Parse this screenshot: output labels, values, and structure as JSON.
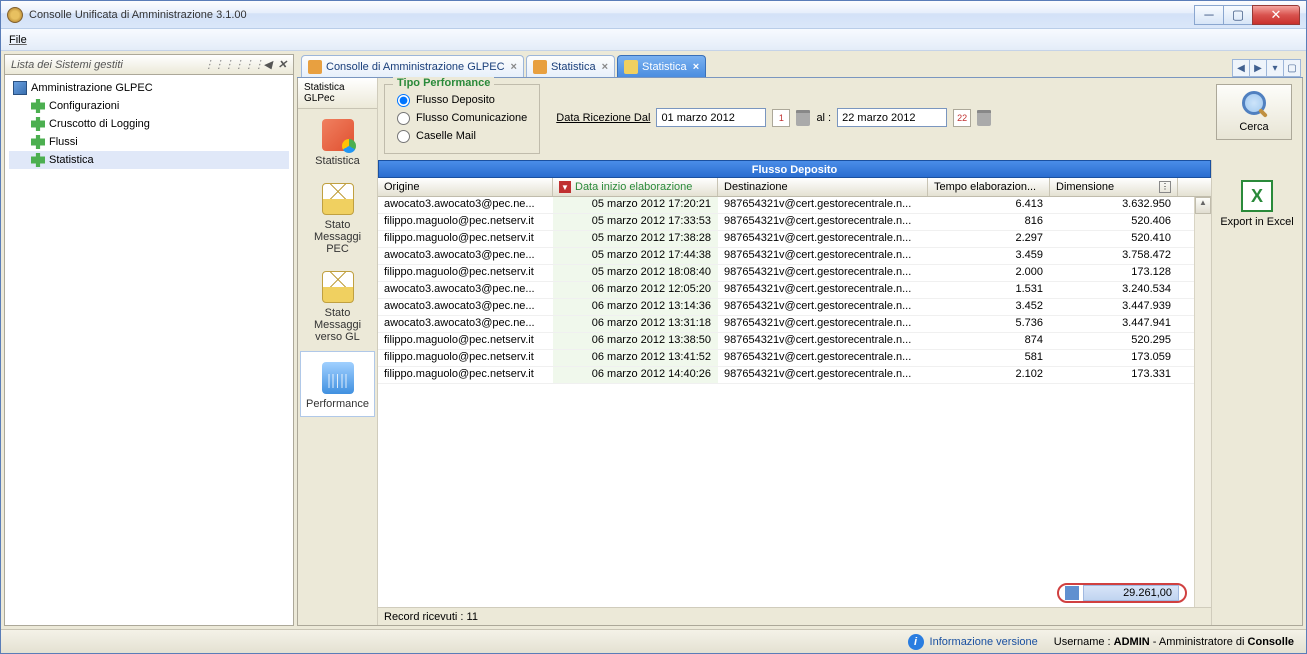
{
  "window": {
    "title": "Consolle Unificata di Amministrazione 3.1.00",
    "menu_file": "File"
  },
  "sidebar": {
    "title": "Lista dei Sistemi gestiti",
    "root": "Amministrazione GLPEC",
    "items": [
      "Configurazioni",
      "Cruscotto di Logging",
      "Flussi",
      "Statistica"
    ]
  },
  "tabs": [
    {
      "label": "Consolle di Amministrazione GLPEC",
      "active": false
    },
    {
      "label": "Statistica",
      "active": false
    },
    {
      "label": "Statistica",
      "active": true
    }
  ],
  "iconbar": {
    "header": "Statistica GLPec",
    "items": [
      "Statistica",
      "Stato Messaggi PEC",
      "Stato Messaggi verso GL",
      "Performance"
    ]
  },
  "perfGroup": {
    "legend": "Tipo Performance",
    "opts": [
      "Flusso Deposito",
      "Flusso Comunicazione",
      "Caselle Mail"
    ]
  },
  "dateFilter": {
    "fromLabel": "Data Ricezione Dal",
    "from": "01 marzo 2012",
    "fromDay": "1",
    "toLabel": "al :",
    "to": "22 marzo 2012",
    "toDay": "22"
  },
  "searchLabel": "Cerca",
  "table": {
    "title": "Flusso Deposito",
    "cols": [
      "Origine",
      "Data inizio elaborazione",
      "Destinazione",
      "Tempo elaborazion...",
      "Dimensione"
    ],
    "rows": [
      {
        "o": "awocato3.awocato3@pec.ne...",
        "d": "05 marzo 2012 17:20:21",
        "dest": "987654321v@cert.gestorecentrale.n...",
        "t": "6.413",
        "dim": "3.632.950"
      },
      {
        "o": "filippo.maguolo@pec.netserv.it",
        "d": "05 marzo 2012 17:33:53",
        "dest": "987654321v@cert.gestorecentrale.n...",
        "t": "816",
        "dim": "520.406"
      },
      {
        "o": "filippo.maguolo@pec.netserv.it",
        "d": "05 marzo 2012 17:38:28",
        "dest": "987654321v@cert.gestorecentrale.n...",
        "t": "2.297",
        "dim": "520.410"
      },
      {
        "o": "awocato3.awocato3@pec.ne...",
        "d": "05 marzo 2012 17:44:38",
        "dest": "987654321v@cert.gestorecentrale.n...",
        "t": "3.459",
        "dim": "3.758.472"
      },
      {
        "o": "filippo.maguolo@pec.netserv.it",
        "d": "05 marzo 2012 18:08:40",
        "dest": "987654321v@cert.gestorecentrale.n...",
        "t": "2.000",
        "dim": "173.128"
      },
      {
        "o": "awocato3.awocato3@pec.ne...",
        "d": "06 marzo 2012 12:05:20",
        "dest": "987654321v@cert.gestorecentrale.n...",
        "t": "1.531",
        "dim": "3.240.534"
      },
      {
        "o": "awocato3.awocato3@pec.ne...",
        "d": "06 marzo 2012 13:14:36",
        "dest": "987654321v@cert.gestorecentrale.n...",
        "t": "3.452",
        "dim": "3.447.939"
      },
      {
        "o": "awocato3.awocato3@pec.ne...",
        "d": "06 marzo 2012 13:31:18",
        "dest": "987654321v@cert.gestorecentrale.n...",
        "t": "5.736",
        "dim": "3.447.941"
      },
      {
        "o": "filippo.maguolo@pec.netserv.it",
        "d": "06 marzo 2012 13:38:50",
        "dest": "987654321v@cert.gestorecentrale.n...",
        "t": "874",
        "dim": "520.295"
      },
      {
        "o": "filippo.maguolo@pec.netserv.it",
        "d": "06 marzo 2012 13:41:52",
        "dest": "987654321v@cert.gestorecentrale.n...",
        "t": "581",
        "dim": "173.059"
      },
      {
        "o": "filippo.maguolo@pec.netserv.it",
        "d": "06 marzo 2012 14:40:26",
        "dest": "987654321v@cert.gestorecentrale.n...",
        "t": "2.102",
        "dim": "173.331"
      }
    ],
    "total": "29.261,00",
    "recordCount": "Record ricevuti : 11"
  },
  "exportLabel": "Export in Excel",
  "status": {
    "version": "Informazione versione",
    "user": "Username : ADMIN - Amministratore di Consolle"
  }
}
